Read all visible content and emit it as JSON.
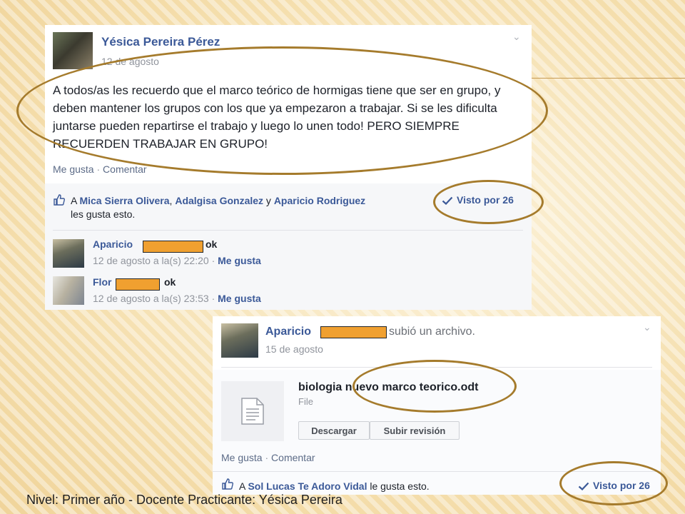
{
  "slide_footer": "Nivel: Primer  año - Docente Practicante: Yésica Pereira",
  "post1": {
    "author": "Yésica Pereira Pérez",
    "date": "12 de agosto",
    "text": "A todos/as les recuerdo que el marco teórico de hormigas tiene que ser en grupo, y deben mantener los grupos con los que ya empezaron a trabajar. Si se les dificulta juntarse pueden repartirse el trabajo y luego lo unen todo! PERO SIEMPRE RECUERDEN TRABAJAR EN GRUPO!",
    "like_label": "Me gusta",
    "comment_label": "Comentar",
    "likes": {
      "prefix": "A",
      "name1": "Mica Sierra Olivera",
      "comma": ",",
      "name2": "Adalgisa Gonzalez",
      "and": "y",
      "name3": "Aparicio Rodriguez",
      "suffix": "les gusta esto."
    },
    "seen": "Visto por 26",
    "comments": [
      {
        "author": "Aparicio",
        "text": "ok",
        "time": "12 de agosto a la(s) 22:20",
        "like": "Me gusta"
      },
      {
        "author": "Flor",
        "text": "ok",
        "time": "12 de agosto a la(s) 23:53",
        "like": "Me gusta"
      }
    ]
  },
  "post2": {
    "author": "Aparicio",
    "action": "subió un archivo.",
    "date": "15 de agosto",
    "file_name": "biologia nuevo marco teorico.odt",
    "file_type": "File",
    "download_label": "Descargar",
    "upload_label": "Subir revisión",
    "like_label": "Me gusta",
    "comment_label": "Comentar",
    "likes": {
      "prefix": "A",
      "name": "Sol Lucas Te Adoro Vidal",
      "suffix": "le gusta esto."
    },
    "seen": "Visto por 26"
  },
  "colors": {
    "fb_blue": "#3b5998",
    "annotation_oval": "#a57b2c",
    "redaction": "#f0a030"
  }
}
